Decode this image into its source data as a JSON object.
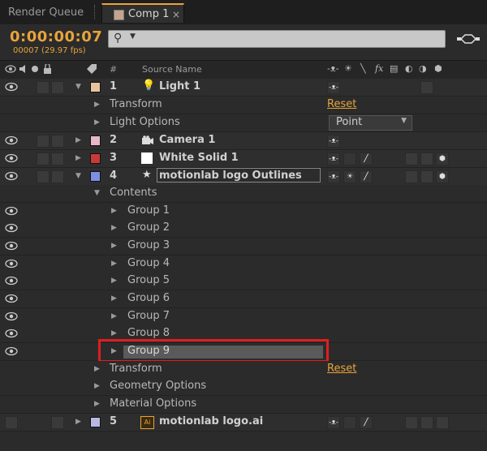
{
  "tabs": {
    "render_queue": "Render Queue",
    "comp": "Comp 1",
    "close": "×"
  },
  "timecode": {
    "time": "0:00:00:07",
    "frames": "00007 (29.97 fps)"
  },
  "search": {
    "icon": "search-icon",
    "placeholder": ""
  },
  "columns": {
    "hash": "#",
    "source_name": "Source Name"
  },
  "colors": {
    "accent": "#e8a43a",
    "highlight": "#e01e1e"
  },
  "layers": [
    {
      "num": "1",
      "name": "Light 1",
      "icon": "light-icon",
      "color": "#e8c3a0"
    },
    {
      "num": "2",
      "name": "Camera 1",
      "icon": "camera-icon",
      "color": "#e6b9c8"
    },
    {
      "num": "3",
      "name": "White Solid 1",
      "icon": "solid-icon",
      "color": "#c83a3a"
    },
    {
      "num": "4",
      "name": "motionlab logo Outlines",
      "icon": "star-icon",
      "color": "#7d8fe0"
    },
    {
      "num": "5",
      "name": "motionlab logo.ai",
      "icon": "ai-file-icon",
      "color": "#b8b8e0"
    }
  ],
  "props": {
    "transform": "Transform",
    "reset": "Reset",
    "light_options": "Light Options",
    "light_type": "Point",
    "contents": "Contents",
    "geometry_options": "Geometry Options",
    "material_options": "Material Options"
  },
  "groups": [
    "Group 1",
    "Group 2",
    "Group 3",
    "Group 4",
    "Group 5",
    "Group 6",
    "Group 7",
    "Group 8",
    "Group 9"
  ]
}
